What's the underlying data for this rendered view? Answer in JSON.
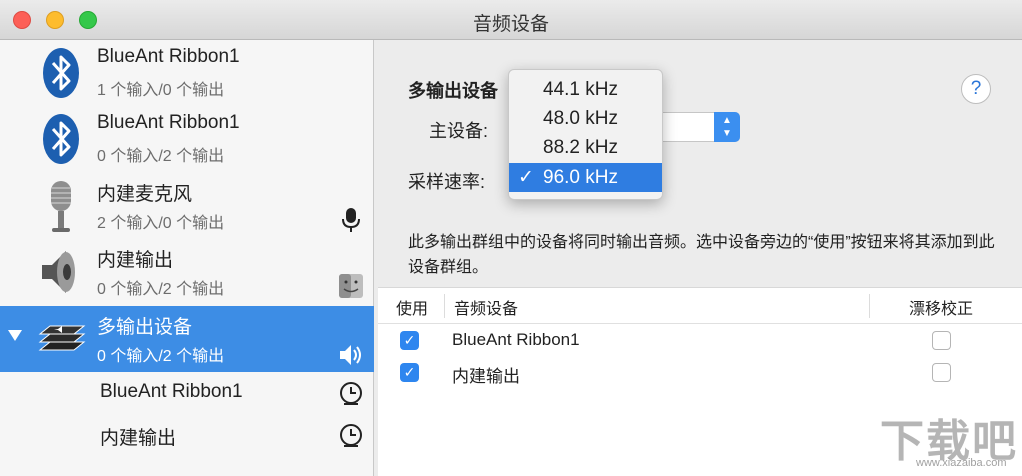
{
  "window": {
    "title": "音频设备"
  },
  "sidebar": {
    "devices": [
      {
        "name": "BlueAnt Ribbon1",
        "io": "1 个输入/0 个输出",
        "icon": "bluetooth-icon"
      },
      {
        "name": "BlueAnt Ribbon1",
        "io": "0 个输入/2 个输出",
        "icon": "bluetooth-icon"
      },
      {
        "name": "内建麦克风",
        "io": "2 个输入/0 个输出",
        "icon": "microphone-icon",
        "status_icon": "mic-input-icon"
      },
      {
        "name": "内建输出",
        "io": "0 个输入/2 个输出",
        "icon": "speaker-icon",
        "status_icon": "finder-icon"
      },
      {
        "name": "多输出设备",
        "io": "0 个输入/2 个输出",
        "icon": "multi-output-icon",
        "status_icon": "speaker-output-icon",
        "selected": true
      }
    ],
    "subdevices": [
      {
        "name": "BlueAnt Ribbon1",
        "icon": "clock-icon"
      },
      {
        "name": "内建输出",
        "icon": "clock-icon"
      }
    ]
  },
  "main": {
    "section_title": "多输出设备",
    "master_label": "主设备:",
    "sample_rate_label": "采样速率:",
    "help": "?",
    "description": "此多输出群组中的设备将同时输出音频。选中设备旁边的“使用”按钮来将其添加到此设备群组。",
    "table": {
      "headers": [
        "使用",
        "音频设备",
        "漂移校正"
      ],
      "rows": [
        {
          "use": true,
          "device": "BlueAnt Ribbon1",
          "drift": false
        },
        {
          "use": true,
          "device": "内建输出",
          "drift": false
        }
      ]
    }
  },
  "sample_rate_menu": {
    "options": [
      "44.1 kHz",
      "48.0 kHz",
      "88.2 kHz",
      "96.0 kHz"
    ],
    "selected": "96.0 kHz",
    "check": "✓"
  },
  "watermark": {
    "text": "下载吧",
    "url": "www.xiazaiba.com"
  },
  "colors": {
    "accent": "#3d8de5",
    "selected_menu": "#2f7de1",
    "checkbox": "#2e86ef"
  }
}
